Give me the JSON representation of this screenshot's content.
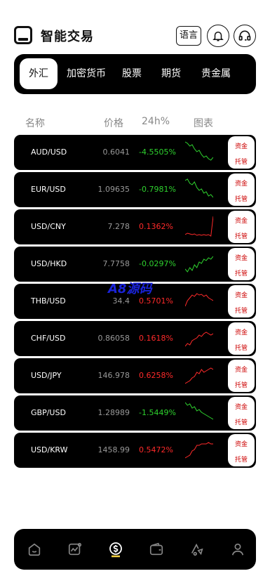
{
  "app": {
    "title": "智能交易",
    "lang_label": "语言"
  },
  "tabs": [
    {
      "label": "外汇",
      "active": true
    },
    {
      "label": "加密货币",
      "active": false
    },
    {
      "label": "股票",
      "active": false
    },
    {
      "label": "期货",
      "active": false
    },
    {
      "label": "贵金属",
      "active": false
    }
  ],
  "columns": {
    "name": "名称",
    "price": "价格",
    "change": "24h%",
    "chart": "图表"
  },
  "trade_button": {
    "line1": "资金",
    "line2": "托管"
  },
  "colors": {
    "up": "#ff2a2a",
    "down": "#2ed12e"
  },
  "rows": [
    {
      "pair": "AUD/USD",
      "price": "0.6041",
      "change": "-4.5505%",
      "dir": "down"
    },
    {
      "pair": "EUR/USD",
      "price": "1.09635",
      "change": "-0.7981%",
      "dir": "down"
    },
    {
      "pair": "USD/CNY",
      "price": "7.278",
      "change": "0.1362%",
      "dir": "up"
    },
    {
      "pair": "USD/HKD",
      "price": "7.7758",
      "change": "-0.0297%",
      "dir": "down"
    },
    {
      "pair": "THB/USD",
      "price": "34.4",
      "change": "0.5701%",
      "dir": "up"
    },
    {
      "pair": "CHF/USD",
      "price": "0.86058",
      "change": "0.1618%",
      "dir": "up"
    },
    {
      "pair": "USD/JPY",
      "price": "146.978",
      "change": "0.6258%",
      "dir": "up"
    },
    {
      "pair": "GBP/USD",
      "price": "1.28989",
      "change": "-1.5449%",
      "dir": "down"
    },
    {
      "pair": "USD/KRW",
      "price": "1458.99",
      "change": "0.5472%",
      "dir": "up"
    }
  ],
  "watermark": "A8源码",
  "bottom_nav": [
    {
      "icon": "home-icon"
    },
    {
      "icon": "market-chart-icon"
    },
    {
      "icon": "trade-dollar-icon",
      "active": true
    },
    {
      "icon": "wallet-icon"
    },
    {
      "icon": "arrows-icon"
    },
    {
      "icon": "user-icon"
    }
  ]
}
